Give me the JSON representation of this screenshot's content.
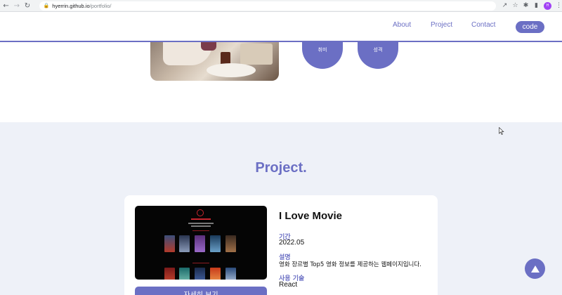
{
  "browser": {
    "url_host": "hyerrin.github.io",
    "url_path": "/portfolio/",
    "avatar_initials": "H"
  },
  "header": {
    "menu": [
      "About",
      "Project",
      "Contact"
    ],
    "code_label": "code"
  },
  "about": {
    "circles": [
      {
        "label": "취미",
        "icon": "bookmark-icon"
      },
      {
        "label": "성격",
        "icon": "heart-icon"
      }
    ]
  },
  "projects": {
    "section_title": "Project.",
    "items": [
      {
        "title": "I Love Movie",
        "period_label": "기간",
        "period": "2022.05",
        "desc_label": "설명",
        "desc": "영화 장르별 Top5 영화 정보를 제공하는 웹페이지입니다.",
        "tech_label": "사용 기술",
        "tech": "React",
        "detail_button": "자세히 보기"
      }
    ]
  },
  "colors": {
    "accent": "#6b6fc4",
    "section_bg": "#eef1f8"
  }
}
